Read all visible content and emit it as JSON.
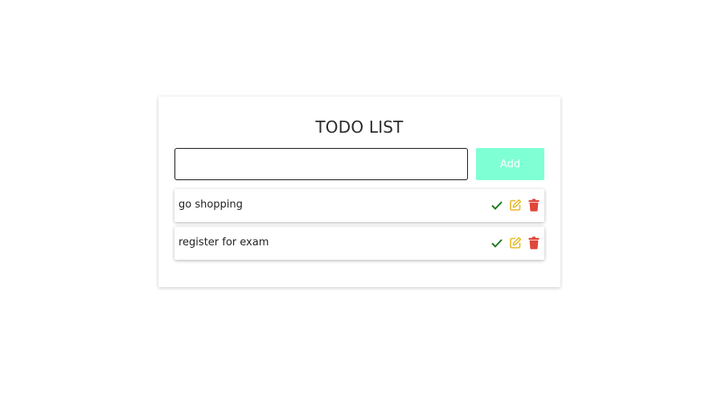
{
  "title": "TODO LIST",
  "input": {
    "value": "",
    "placeholder": ""
  },
  "add_button": {
    "label": "Add",
    "color": "#7fffd4"
  },
  "items": [
    {
      "label": "go shopping"
    },
    {
      "label": "register for exam"
    }
  ],
  "icons": {
    "complete": "check-icon",
    "edit": "edit-icon",
    "delete": "trash-icon"
  },
  "colors": {
    "check": "#1f7a1f",
    "edit": "#e8b923",
    "delete": "#e0463a"
  }
}
